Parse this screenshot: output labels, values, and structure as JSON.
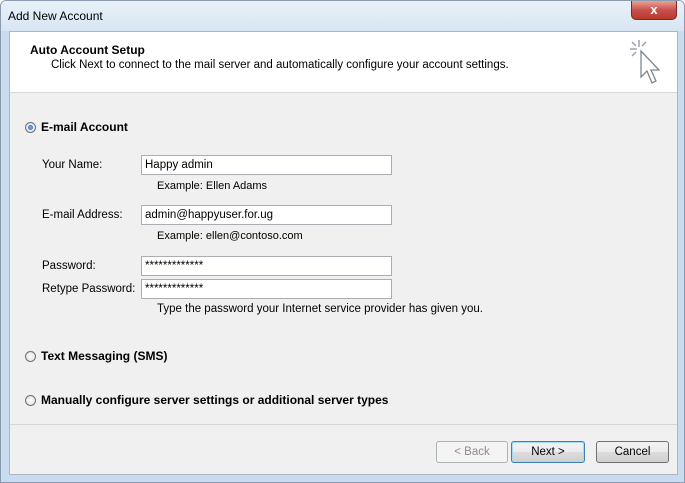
{
  "window": {
    "title": "Add New Account",
    "close_label": "x"
  },
  "header": {
    "title": "Auto Account Setup",
    "description": "Click Next to connect to the mail server and automatically configure your account settings.",
    "icon": "cursor-click-icon"
  },
  "options": {
    "email_account": {
      "label": "E-mail Account",
      "selected": true
    },
    "text_messaging": {
      "label": "Text Messaging (SMS)",
      "selected": false
    },
    "manual_config": {
      "label": "Manually configure server settings or additional server types",
      "selected": false
    }
  },
  "form": {
    "your_name": {
      "label": "Your Name:",
      "value": "Happy admin",
      "example": "Example: Ellen Adams"
    },
    "email": {
      "label": "E-mail Address:",
      "value": "admin@happyuser.for.ug",
      "example": "Example: ellen@contoso.com"
    },
    "password": {
      "label": "Password:",
      "value": "*************"
    },
    "retype_password": {
      "label": "Retype Password:",
      "value": "*************"
    },
    "password_hint": "Type the password your Internet service provider has given you."
  },
  "buttons": {
    "back": "< Back",
    "next": "Next >",
    "cancel": "Cancel"
  },
  "colors": {
    "close_button": "#c75050",
    "frame": "#c9dbee",
    "client_bg": "#f0f0f0"
  }
}
